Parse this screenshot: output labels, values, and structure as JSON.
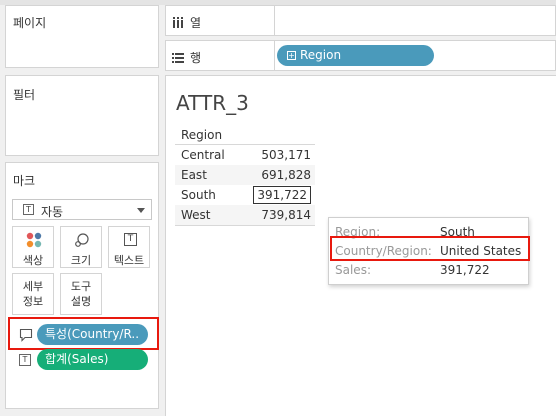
{
  "left_pane": {
    "pages_title": "페이지",
    "filters_title": "필터",
    "marks_title": "마크"
  },
  "marks": {
    "type_value": "자동",
    "type_icon": "text-icon",
    "buttons": [
      {
        "label": "색상",
        "icon": "color-dots-icon"
      },
      {
        "label": "크기",
        "icon": "size-icon"
      },
      {
        "label": "텍스트",
        "icon": "text-icon"
      },
      {
        "label": "세부\n정보",
        "icon": ""
      },
      {
        "label": "도구\n설명",
        "icon": ""
      }
    ],
    "fields": [
      {
        "label": "특성(Country/R..",
        "icon": "tooltip-icon",
        "color": "#4a9abb"
      },
      {
        "label": "합계(Sales)",
        "icon": "text-icon",
        "color": "#16ae78"
      }
    ]
  },
  "shelves": {
    "columns_label": "열",
    "rows_label": "행",
    "rows_pill": "Region"
  },
  "sheet": {
    "title": "ATTR_3",
    "header": "Region",
    "rows": [
      {
        "region": "Central",
        "value": "503,171"
      },
      {
        "region": "East",
        "value": "691,828"
      },
      {
        "region": "South",
        "value": "391,722"
      },
      {
        "region": "West",
        "value": "739,814"
      }
    ]
  },
  "tooltip": {
    "rows": [
      {
        "key": "Region:",
        "value": "South"
      },
      {
        "key": "Country/Region:",
        "value": "United States"
      },
      {
        "key": "Sales:",
        "value": "391,722"
      }
    ]
  },
  "colors": {
    "highlight": "#e8190e",
    "pill_blue": "#4a9abb",
    "pill_green": "#16ae78"
  }
}
